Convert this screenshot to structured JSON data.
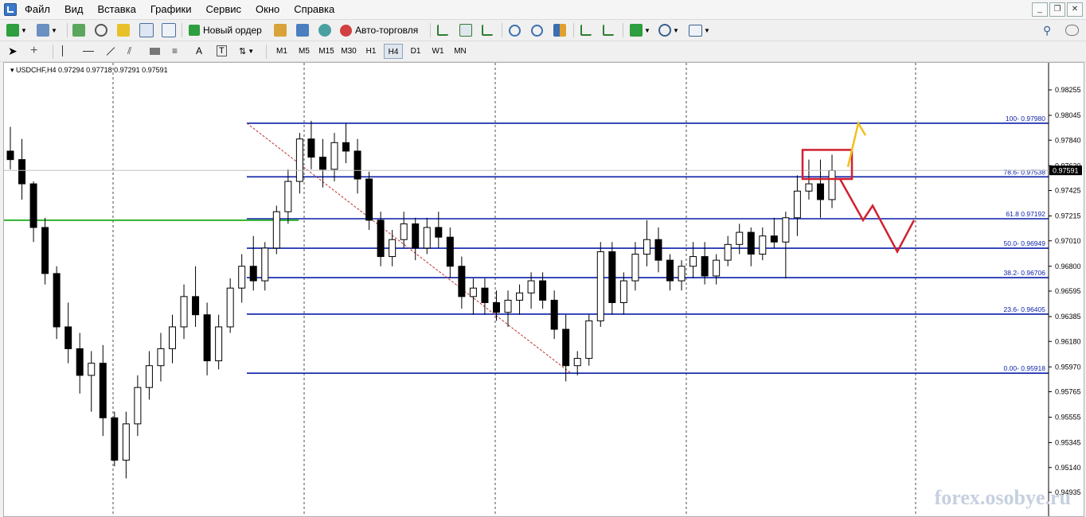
{
  "menu": [
    "Файл",
    "Вид",
    "Вставка",
    "Графики",
    "Сервис",
    "Окно",
    "Справка"
  ],
  "toolbar": {
    "new_order": "Новый ордер",
    "auto_trading": "Авто-торговля"
  },
  "timeframes": [
    "M1",
    "M5",
    "M15",
    "M30",
    "H1",
    "H4",
    "D1",
    "W1",
    "MN"
  ],
  "active_timeframe": "H4",
  "chart": {
    "symbol_info": "USDCHF,H4  0.97294 0.97718 0.97291 0.97591",
    "current_price": "0.97591",
    "watermark": "forex.osobye.ru",
    "fib_labels": [
      "100- 0.97980",
      "78.6- 0.97538",
      "61.8 0.97192",
      "50.0- 0.96949",
      "38.2- 0.96706",
      "23.6- 0.96405",
      "0.00- 0.95918"
    ]
  },
  "chart_data": {
    "type": "candlestick",
    "y_ticks": [
      "0.98255",
      "0.98045",
      "0.97840",
      "0.97630",
      "0.97425",
      "0.97215",
      "0.97010",
      "0.96800",
      "0.96595",
      "0.96385",
      "0.96180",
      "0.95970",
      "0.95765",
      "0.95555",
      "0.95345",
      "0.95140",
      "0.94935"
    ],
    "fibonacci_levels": [
      {
        "level": "100",
        "price": 0.9798
      },
      {
        "level": "78.6",
        "price": 0.97538
      },
      {
        "level": "61.8",
        "price": 0.97192
      },
      {
        "level": "50.0",
        "price": 0.96949
      },
      {
        "level": "38.2",
        "price": 0.96706
      },
      {
        "level": "23.6",
        "price": 0.96405
      },
      {
        "level": "0.00",
        "price": 0.95918
      }
    ],
    "ohlc": [
      [
        0.9775,
        0.9795,
        0.976,
        0.9768
      ],
      [
        0.9768,
        0.9785,
        0.9735,
        0.9748
      ],
      [
        0.9748,
        0.975,
        0.97,
        0.9712
      ],
      [
        0.9712,
        0.972,
        0.9665,
        0.9674
      ],
      [
        0.9674,
        0.968,
        0.962,
        0.963
      ],
      [
        0.963,
        0.965,
        0.96,
        0.9612
      ],
      [
        0.9612,
        0.9625,
        0.9575,
        0.959
      ],
      [
        0.959,
        0.961,
        0.956,
        0.96
      ],
      [
        0.96,
        0.9615,
        0.954,
        0.9555
      ],
      [
        0.9555,
        0.956,
        0.9515,
        0.952
      ],
      [
        0.952,
        0.956,
        0.9505,
        0.955
      ],
      [
        0.955,
        0.959,
        0.954,
        0.958
      ],
      [
        0.958,
        0.961,
        0.957,
        0.9598
      ],
      [
        0.9598,
        0.9625,
        0.9585,
        0.9612
      ],
      [
        0.9612,
        0.964,
        0.96,
        0.963
      ],
      [
        0.963,
        0.9665,
        0.962,
        0.9655
      ],
      [
        0.9655,
        0.968,
        0.963,
        0.964
      ],
      [
        0.964,
        0.965,
        0.959,
        0.9602
      ],
      [
        0.9602,
        0.964,
        0.9595,
        0.963
      ],
      [
        0.963,
        0.967,
        0.9625,
        0.9662
      ],
      [
        0.9662,
        0.969,
        0.965,
        0.968
      ],
      [
        0.968,
        0.9705,
        0.966,
        0.9668
      ],
      [
        0.9668,
        0.97,
        0.966,
        0.9695
      ],
      [
        0.9695,
        0.973,
        0.969,
        0.9725
      ],
      [
        0.9725,
        0.976,
        0.9715,
        0.975
      ],
      [
        0.975,
        0.979,
        0.974,
        0.9785
      ],
      [
        0.9785,
        0.98,
        0.976,
        0.977
      ],
      [
        0.977,
        0.9785,
        0.9745,
        0.976
      ],
      [
        0.976,
        0.979,
        0.975,
        0.9782
      ],
      [
        0.9782,
        0.9798,
        0.9765,
        0.9775
      ],
      [
        0.9775,
        0.9785,
        0.974,
        0.9752
      ],
      [
        0.9752,
        0.9758,
        0.971,
        0.9718
      ],
      [
        0.9718,
        0.9725,
        0.968,
        0.9688
      ],
      [
        0.9688,
        0.971,
        0.968,
        0.9702
      ],
      [
        0.9702,
        0.9725,
        0.9695,
        0.9715
      ],
      [
        0.9715,
        0.972,
        0.9685,
        0.9695
      ],
      [
        0.9695,
        0.972,
        0.969,
        0.9712
      ],
      [
        0.9712,
        0.9725,
        0.9695,
        0.9704
      ],
      [
        0.9704,
        0.9712,
        0.967,
        0.968
      ],
      [
        0.968,
        0.9688,
        0.9645,
        0.9655
      ],
      [
        0.9655,
        0.967,
        0.964,
        0.9662
      ],
      [
        0.9662,
        0.967,
        0.964,
        0.965
      ],
      [
        0.965,
        0.966,
        0.9635,
        0.9642
      ],
      [
        0.9642,
        0.966,
        0.963,
        0.9652
      ],
      [
        0.9652,
        0.9665,
        0.964,
        0.9658
      ],
      [
        0.9658,
        0.9675,
        0.9645,
        0.9668
      ],
      [
        0.9668,
        0.9675,
        0.9645,
        0.9652
      ],
      [
        0.9652,
        0.966,
        0.962,
        0.9628
      ],
      [
        0.9628,
        0.964,
        0.9585,
        0.9598
      ],
      [
        0.9598,
        0.961,
        0.959,
        0.9604
      ],
      [
        0.9604,
        0.964,
        0.9598,
        0.9635
      ],
      [
        0.9635,
        0.97,
        0.963,
        0.9692
      ],
      [
        0.9692,
        0.97,
        0.964,
        0.965
      ],
      [
        0.965,
        0.9675,
        0.964,
        0.9668
      ],
      [
        0.9668,
        0.97,
        0.966,
        0.969
      ],
      [
        0.969,
        0.9718,
        0.968,
        0.9702
      ],
      [
        0.9702,
        0.9712,
        0.9675,
        0.9685
      ],
      [
        0.9685,
        0.969,
        0.966,
        0.9668
      ],
      [
        0.9668,
        0.9685,
        0.966,
        0.968
      ],
      [
        0.968,
        0.97,
        0.967,
        0.9688
      ],
      [
        0.9688,
        0.97,
        0.9665,
        0.9672
      ],
      [
        0.9672,
        0.969,
        0.9665,
        0.9685
      ],
      [
        0.9685,
        0.9705,
        0.968,
        0.9698
      ],
      [
        0.9698,
        0.9715,
        0.969,
        0.9708
      ],
      [
        0.9708,
        0.9712,
        0.968,
        0.969
      ],
      [
        0.969,
        0.9712,
        0.9685,
        0.9705
      ],
      [
        0.9705,
        0.972,
        0.9695,
        0.97
      ],
      [
        0.97,
        0.9725,
        0.967,
        0.972
      ],
      [
        0.972,
        0.9755,
        0.9705,
        0.9742
      ],
      [
        0.9742,
        0.9768,
        0.9735,
        0.9748
      ],
      [
        0.9748,
        0.9768,
        0.972,
        0.9735
      ],
      [
        0.9735,
        0.9772,
        0.9728,
        0.9759
      ]
    ]
  }
}
